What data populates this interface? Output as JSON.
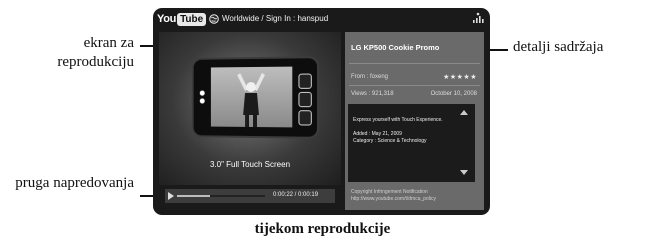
{
  "annotations": {
    "screen_label": "ekran za reprodukciju",
    "details_label": "detalji sadržaja",
    "progress_label": "pruga napredovanja",
    "caption": "tijekom reprodukcije"
  },
  "tv": {
    "logo_you": "You",
    "logo_tube": "Tube",
    "location": "Worldwide / Sign In : hanspud",
    "phone_caption": "3.0\" Full Touch Screen",
    "progress": {
      "time": "0:00:22 / 0:00:19",
      "fraction": 0.38
    },
    "details": {
      "title": "LG KP500 Cookie Promo",
      "from": "From : foxeng",
      "stars": "★★★★★",
      "views": "Views : 921,318",
      "date": "October 10, 2008",
      "description_lines": [
        "Express yourself with Touch Experience.",
        "Added : May 21, 2009",
        "Category : Science & Technology"
      ],
      "copyright_lines": [
        "Copyright Infringement Notification",
        "http://www.youtube.com/t/dmca_policy"
      ]
    }
  }
}
